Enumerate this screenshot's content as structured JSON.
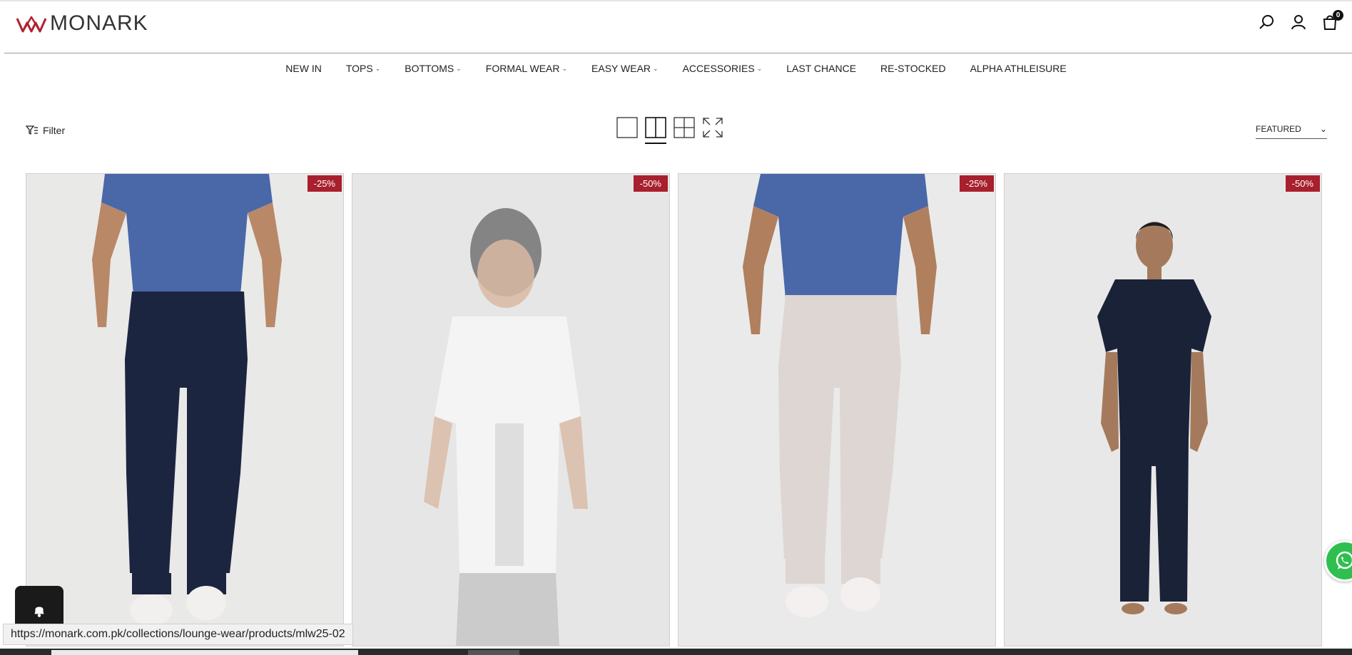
{
  "header": {
    "brand": "MONARK",
    "cart_count": "0",
    "icons": [
      "search-icon",
      "user-icon",
      "bag-icon"
    ]
  },
  "nav": [
    {
      "label": "NEW IN",
      "dropdown": false
    },
    {
      "label": "TOPS",
      "dropdown": true
    },
    {
      "label": "BOTTOMS",
      "dropdown": true
    },
    {
      "label": "FORMAL WEAR",
      "dropdown": true
    },
    {
      "label": "EASY WEAR",
      "dropdown": true
    },
    {
      "label": "ACCESSORIES",
      "dropdown": true
    },
    {
      "label": "LAST CHANCE",
      "dropdown": false
    },
    {
      "label": "RE-STOCKED",
      "dropdown": false
    },
    {
      "label": "ALPHA ATHLEISURE",
      "dropdown": false
    }
  ],
  "toolbar": {
    "filter_label": "Filter",
    "sort_label": "FEATURED",
    "active_view": "2-columns"
  },
  "products": [
    {
      "badge": "-25%",
      "shirt_color": "#4a67a8",
      "pants_color": "#1c2540"
    },
    {
      "badge": "-50%",
      "shirt_color": "#f4f4f4",
      "pants_color": "#c8c8c8"
    },
    {
      "badge": "-25%",
      "shirt_color": "#4a67a8",
      "pants_color": "#ddd6d2"
    },
    {
      "badge": "-50%",
      "shirt_color": "#1a2238",
      "pants_color": "#1a2238"
    }
  ],
  "status_url": "https://monark.com.pk/collections/lounge-wear/products/mlw25-02",
  "colors": {
    "accent_red": "#a8202d",
    "whatsapp": "#2fbf4f"
  }
}
